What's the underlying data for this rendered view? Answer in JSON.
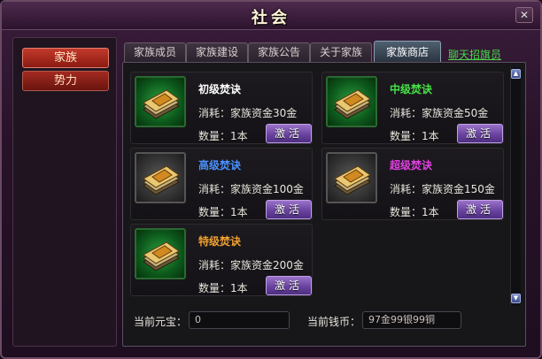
{
  "window": {
    "title": "社会",
    "close_symbol": "✕"
  },
  "sidebar": {
    "items": [
      {
        "label": "家族"
      },
      {
        "label": "势力"
      }
    ]
  },
  "tabs": [
    {
      "label": "家族成员"
    },
    {
      "label": "家族建设"
    },
    {
      "label": "家族公告"
    },
    {
      "label": "关于家族"
    },
    {
      "label": "家族商店"
    }
  ],
  "active_tab": "家族商店",
  "recruit_link": "聊天招旗员",
  "shop": {
    "items": [
      {
        "name": "初级焚诀",
        "name_color": "#ffffff",
        "cost": "消耗：家族资金30金",
        "qty": "数量：1本",
        "button": "激活",
        "icon": "book-icon-green"
      },
      {
        "name": "中级焚诀",
        "name_color": "#48e048",
        "cost": "消耗：家族资金50金",
        "qty": "数量：1本",
        "button": "激活",
        "icon": "book-icon-green"
      },
      {
        "name": "高级焚诀",
        "name_color": "#4a90ff",
        "cost": "消耗：家族资金100金",
        "qty": "数量：1本",
        "button": "激活",
        "icon": "book-icon-gray"
      },
      {
        "name": "超级焚诀",
        "name_color": "#e040e0",
        "cost": "消耗：家族资金150金",
        "qty": "数量：1本",
        "button": "激活",
        "icon": "book-icon-gray"
      },
      {
        "name": "特级焚诀",
        "name_color": "#f0a030",
        "cost": "消耗：家族资金200金",
        "qty": "数量：1本",
        "button": "激活",
        "icon": "book-icon-green"
      }
    ]
  },
  "footer": {
    "yuanbao_label": "当前元宝：",
    "yuanbao_value": "0",
    "coins_label": "当前钱币：",
    "coins_value": "97金99银99铜"
  },
  "colors": {
    "accent_red": "#c23a2c",
    "button_purple": "#6a44a0",
    "link_green": "#48d848"
  }
}
